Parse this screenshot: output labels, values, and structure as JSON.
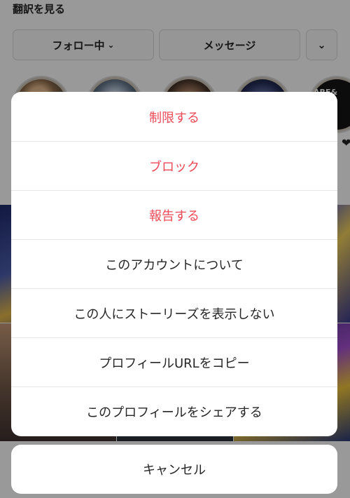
{
  "background": {
    "translate_label": "翻訳を見る",
    "follow_button": "フォロー中",
    "message_button": "メッセージ",
    "highlight_5_text": "ARE&\nCH &\nRIES"
  },
  "sheet": {
    "restrict": "制限する",
    "block": "ブロック",
    "report": "報告する",
    "about": "このアカウントについて",
    "hide_story": "この人にストーリーズを表示しない",
    "copy_url": "プロフィールURLをコピー",
    "share": "このプロフィールをシェアする"
  },
  "cancel": "キャンセル",
  "colors": {
    "danger": "#ed4956",
    "text": "#262626",
    "overlay": "rgba(0,0,0,0.40)"
  }
}
